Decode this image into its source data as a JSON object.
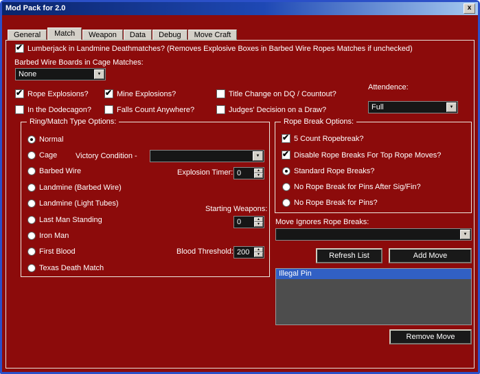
{
  "window": {
    "title": "Mod Pack for 2.0",
    "close_label": "x"
  },
  "icons": {
    "check": "✔",
    "dropdown_arrow": "▼",
    "spinner_up": "▲",
    "spinner_down": "▼"
  },
  "colors": {
    "background": "#8C0B0B",
    "titlebar_left": "#0A246A",
    "titlebar_right": "#A6CAF0",
    "selection": "#3160C4",
    "control_dark": "#161616"
  },
  "tabs": {
    "selected_label": "Match",
    "items": [
      {
        "label": "General"
      },
      {
        "label": "Match"
      },
      {
        "label": "Weapon"
      },
      {
        "label": "Data"
      },
      {
        "label": "Debug"
      },
      {
        "label": "Move Craft"
      }
    ]
  },
  "top": {
    "lumberjack": {
      "label": "Lumberjack in Landmine Deathmatches? (Removes Explosive Boxes in Barbed Wire Ropes Matches if unchecked)",
      "checked": true
    },
    "cage_boards_label": "Barbed Wire Boards in Cage Matches:",
    "cage_boards_value": "None",
    "row1": [
      {
        "label": "Rope Explosions?",
        "checked": true
      },
      {
        "label": "Mine Explosions?",
        "checked": true
      },
      {
        "label": "Title Change on DQ / Countout?",
        "checked": false
      }
    ],
    "row2": [
      {
        "label": "In the Dodecagon?",
        "checked": false
      },
      {
        "label": "Falls Count Anywhere?",
        "checked": false
      },
      {
        "label": "Judges' Decision on a Draw?",
        "checked": false
      }
    ],
    "attendence_label": "Attendence:",
    "attendence_value": "Full"
  },
  "ring_options": {
    "title": "Ring/Match Type Options:",
    "radios": [
      {
        "label": "Normal",
        "selected": true
      },
      {
        "label": "Cage",
        "selected": false
      },
      {
        "label": "Barbed Wire",
        "selected": false
      },
      {
        "label": "Landmine (Barbed Wire)",
        "selected": false
      },
      {
        "label": "Landmine (Light Tubes)",
        "selected": false
      },
      {
        "label": "Last Man Standing",
        "selected": false
      },
      {
        "label": "Iron Man",
        "selected": false
      },
      {
        "label": "First Blood",
        "selected": false
      },
      {
        "label": "Texas Death Match",
        "selected": false
      }
    ],
    "victory_condition_label": "Victory Condition -",
    "victory_condition_value": "",
    "explosion_timer_label": "Explosion Timer:",
    "explosion_timer_value": "0",
    "starting_weapons_label": "Starting Weapons:",
    "starting_weapons_value": "0",
    "blood_threshold_label": "Blood Threshold:",
    "blood_threshold_value": "200"
  },
  "rope_options": {
    "title": "Rope Break Options:",
    "checkboxes": [
      {
        "label": "5 Count Ropebreak?",
        "checked": true
      },
      {
        "label": "Disable Rope Breaks For Top Rope Moves?",
        "checked": true
      }
    ],
    "radios": [
      {
        "label": "Standard Rope Breaks?",
        "selected": true
      },
      {
        "label": "No Rope Break for Pins After Sig/Fin?",
        "selected": false
      },
      {
        "label": "No Rope Break for Pins?",
        "selected": false
      }
    ]
  },
  "move_section": {
    "label": "Move Ignores Rope Breaks:",
    "dropdown_value": "",
    "refresh_button": "Refresh List",
    "add_button": "Add Move",
    "list_items": [
      {
        "label": "Illegal Pin",
        "selected": true
      }
    ],
    "remove_button": "Remove Move"
  }
}
